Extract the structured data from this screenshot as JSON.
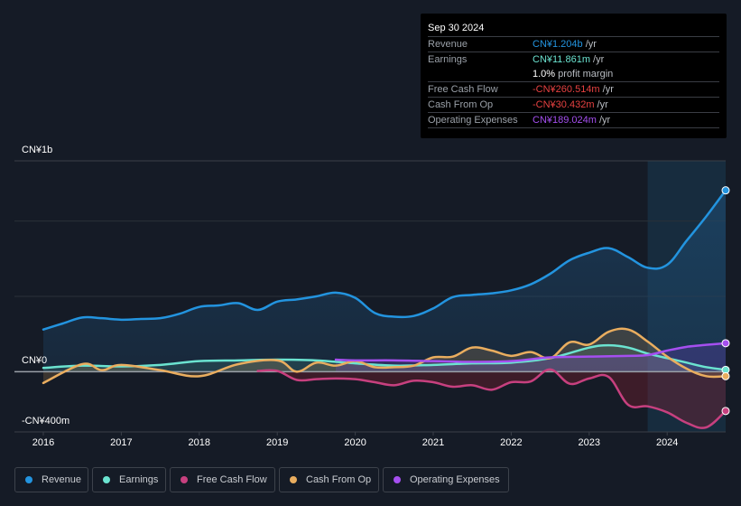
{
  "tooltip": {
    "date": "Sep 30 2024",
    "rows": [
      {
        "label": "Revenue",
        "value": "CN¥1.204b",
        "unit": " /yr",
        "color": "#2394df"
      },
      {
        "label": "Earnings",
        "value": "CN¥11.861m",
        "unit": " /yr",
        "color": "#6be3d0"
      },
      {
        "label": "",
        "value": "1.0%",
        "unit": " profit margin",
        "color": "#ffffff"
      },
      {
        "label": "Free Cash Flow",
        "value": "-CN¥260.514m",
        "unit": " /yr",
        "color": "#e64141"
      },
      {
        "label": "Cash From Op",
        "value": "-CN¥30.432m",
        "unit": " /yr",
        "color": "#e64141"
      },
      {
        "label": "Operating Expenses",
        "value": "CN¥189.024m",
        "unit": " /yr",
        "color": "#a54ff0"
      }
    ]
  },
  "legend": [
    {
      "label": "Revenue",
      "color": "#2394df"
    },
    {
      "label": "Earnings",
      "color": "#6be3d0"
    },
    {
      "label": "Free Cash Flow",
      "color": "#c7407f"
    },
    {
      "label": "Cash From Op",
      "color": "#e9ad5f"
    },
    {
      "label": "Operating Expenses",
      "color": "#a54ff0"
    }
  ],
  "chart_data": {
    "type": "area",
    "title": "",
    "xlabel": "",
    "ylabel": "",
    "units": "CN¥ millions",
    "y_tick_labels": [
      "CN¥1b",
      "CN¥0",
      "-CN¥400m"
    ],
    "y_ticks": [
      1000,
      0,
      -400
    ],
    "ylim": [
      -400,
      1400
    ],
    "xlim": [
      2016.0,
      2024.75
    ],
    "x_tick_labels": [
      "2016",
      "2017",
      "2018",
      "2019",
      "2020",
      "2021",
      "2022",
      "2023",
      "2024"
    ],
    "x_ticks": [
      2016,
      2017,
      2018,
      2019,
      2020,
      2021,
      2022,
      2023,
      2024
    ],
    "grid": true,
    "forecast_shade_start": 2023.75,
    "legend_position": "bottom",
    "series": [
      {
        "name": "Revenue",
        "color": "#2394df",
        "x": [
          2016.0,
          2016.25,
          2016.5,
          2016.75,
          2017.0,
          2017.25,
          2017.5,
          2017.75,
          2018.0,
          2018.25,
          2018.5,
          2018.75,
          2019.0,
          2019.25,
          2019.5,
          2019.75,
          2020.0,
          2020.25,
          2020.5,
          2020.75,
          2021.0,
          2021.25,
          2021.5,
          2021.75,
          2022.0,
          2022.25,
          2022.5,
          2022.75,
          2023.0,
          2023.25,
          2023.5,
          2023.75,
          2024.0,
          2024.25,
          2024.5,
          2024.75
        ],
        "values": [
          280,
          320,
          360,
          355,
          345,
          350,
          355,
          385,
          430,
          440,
          455,
          410,
          465,
          480,
          500,
          525,
          490,
          390,
          365,
          370,
          420,
          495,
          510,
          520,
          540,
          580,
          650,
          740,
          790,
          820,
          760,
          690,
          710,
          870,
          1030,
          1204
        ]
      },
      {
        "name": "Earnings",
        "color": "#6be3d0",
        "x": [
          2016.0,
          2016.5,
          2017.0,
          2017.5,
          2018.0,
          2018.5,
          2019.0,
          2019.5,
          2020.0,
          2020.5,
          2021.0,
          2021.5,
          2022.0,
          2022.5,
          2023.0,
          2023.25,
          2023.5,
          2023.75,
          2024.0,
          2024.25,
          2024.5,
          2024.75
        ],
        "values": [
          25,
          40,
          35,
          45,
          70,
          75,
          80,
          75,
          55,
          40,
          45,
          55,
          60,
          90,
          160,
          175,
          160,
          120,
          90,
          60,
          30,
          12
        ]
      },
      {
        "name": "Free Cash Flow",
        "color": "#c7407f",
        "x": [
          2018.75,
          2019.0,
          2019.25,
          2019.5,
          2019.75,
          2020.0,
          2020.25,
          2020.5,
          2020.75,
          2021.0,
          2021.25,
          2021.5,
          2021.75,
          2022.0,
          2022.25,
          2022.5,
          2022.75,
          2023.0,
          2023.25,
          2023.5,
          2023.75,
          2024.0,
          2024.25,
          2024.5,
          2024.75
        ],
        "values": [
          5,
          5,
          -55,
          -50,
          -45,
          -50,
          -70,
          -90,
          -60,
          -70,
          -100,
          -90,
          -120,
          -70,
          -65,
          15,
          -80,
          -45,
          -35,
          -220,
          -230,
          -270,
          -340,
          -370,
          -261
        ]
      },
      {
        "name": "Cash From Op",
        "color": "#e9ad5f",
        "x": [
          2016.0,
          2016.5,
          2016.75,
          2017.0,
          2017.5,
          2018.0,
          2018.5,
          2019.0,
          2019.25,
          2019.5,
          2019.75,
          2020.0,
          2020.25,
          2020.5,
          2020.75,
          2021.0,
          2021.25,
          2021.5,
          2021.75,
          2022.0,
          2022.25,
          2022.5,
          2022.75,
          2023.0,
          2023.25,
          2023.5,
          2023.75,
          2024.0,
          2024.25,
          2024.5,
          2024.75
        ],
        "values": [
          -75,
          50,
          10,
          45,
          10,
          -30,
          50,
          75,
          0,
          60,
          40,
          70,
          30,
          30,
          40,
          95,
          100,
          160,
          140,
          105,
          130,
          90,
          195,
          180,
          265,
          280,
          200,
          100,
          20,
          -30,
          -30
        ]
      },
      {
        "name": "Operating Expenses",
        "color": "#a54ff0",
        "x": [
          2019.75,
          2020.0,
          2020.5,
          2021.0,
          2021.5,
          2022.0,
          2022.5,
          2023.0,
          2023.5,
          2023.75,
          2024.0,
          2024.25,
          2024.5,
          2024.75
        ],
        "values": [
          80,
          75,
          75,
          70,
          65,
          70,
          95,
          100,
          105,
          110,
          140,
          165,
          178,
          189
        ]
      }
    ]
  }
}
